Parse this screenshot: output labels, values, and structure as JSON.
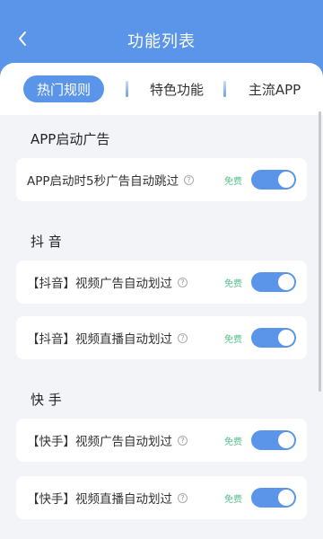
{
  "header": {
    "title": "功能列表",
    "back_icon": "chevron-left-icon"
  },
  "tabs": [
    {
      "label": "热门规则",
      "active": true
    },
    {
      "label": "特色功能",
      "active": false
    },
    {
      "label": "主流APP",
      "active": false
    }
  ],
  "sections": [
    {
      "title": "APP启动广告",
      "items": [
        {
          "label": "APP启动时5秒广告自动跳过",
          "badge": "免费",
          "enabled": true
        }
      ]
    },
    {
      "title": "抖 音",
      "items": [
        {
          "label": "【抖音】视频广告自动划过",
          "badge": "免费",
          "enabled": true
        },
        {
          "label": "【抖音】视频直播自动划过",
          "badge": "免费",
          "enabled": true
        }
      ]
    },
    {
      "title": "快 手",
      "items": [
        {
          "label": "【快手】视频广告自动划过",
          "badge": "免费",
          "enabled": true
        },
        {
          "label": "【快手】视频直播自动划过",
          "badge": "免费",
          "enabled": true
        }
      ]
    }
  ],
  "colors": {
    "accent": "#5b95ea",
    "badge": "#55c18a",
    "background": "#f3f4f7"
  }
}
